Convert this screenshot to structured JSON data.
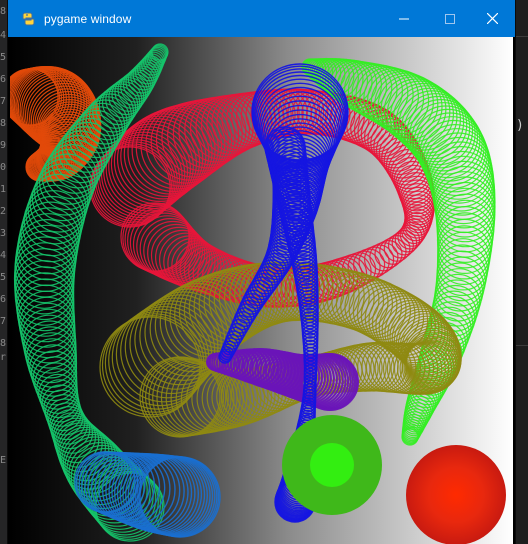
{
  "window": {
    "title": "pygame window",
    "app_icon": "pygame-snake-icon",
    "controls": {
      "minimize": "minimize-icon",
      "maximize": "maximize-icon",
      "close": "close-icon"
    },
    "titlebar_color": "#0078d7"
  },
  "editor_behind": {
    "gutter_chars": [
      "8",
      "4",
      "5",
      "6",
      "7",
      "8",
      "9",
      "0",
      "1",
      "2",
      "3",
      "4",
      "5",
      "6",
      "7",
      "8",
      "r",
      "",
      "",
      "E"
    ],
    "right_glyph": ")"
  },
  "scene": {
    "background": "horizontal gradient black to white",
    "spirals": [
      {
        "name": "orange-spiral",
        "color": "#e24a0a"
      },
      {
        "name": "crimson-spiral",
        "color": "#e8153a"
      },
      {
        "name": "teal-green-spiral",
        "color": "#15c46a"
      },
      {
        "name": "blue-spiral",
        "color": "#1515e0"
      },
      {
        "name": "bright-green-spiral",
        "color": "#33ee22"
      },
      {
        "name": "olive-spiral",
        "color": "#8f8a12"
      },
      {
        "name": "purple-spiral",
        "color": "#6a14b8"
      },
      {
        "name": "steel-blue-spiral",
        "color": "#1a6fd0"
      }
    ],
    "balls": [
      {
        "name": "green-ball",
        "color": "#3fb81a"
      },
      {
        "name": "red-ball",
        "color": "#e6200c"
      }
    ]
  }
}
